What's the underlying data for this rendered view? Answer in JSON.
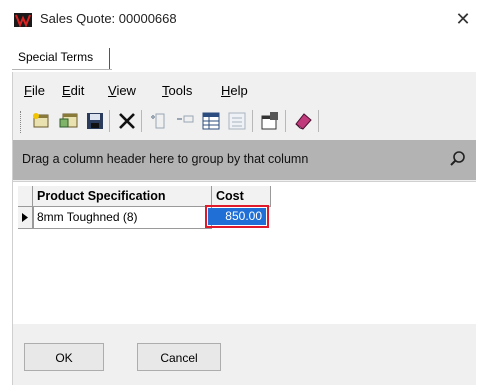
{
  "window": {
    "title": "Sales Quote: 00000668",
    "close_glyph": "✕"
  },
  "tab": {
    "label": "Special Terms"
  },
  "menu": {
    "items": [
      {
        "label": "File"
      },
      {
        "label": "Edit"
      },
      {
        "label": "View"
      },
      {
        "label": "Tools"
      },
      {
        "label": "Help"
      }
    ]
  },
  "toolbar": {
    "icons": [
      "new-record-icon",
      "new-child-icon",
      "save-icon",
      "delete-icon",
      "insert-row-icon",
      "remove-row-icon",
      "grid-view-icon",
      "card-view-icon",
      "properties-icon",
      "eraser-icon"
    ]
  },
  "grid": {
    "group_hint": "Drag a column header here to group by that column",
    "columns": [
      "Product Specification",
      "Cost"
    ],
    "rows": [
      {
        "product": "8mm Toughned (8)",
        "cost": "850.00"
      }
    ],
    "colors": {
      "selection": "#1f6fd6",
      "highlight_border": "#e01a2b"
    }
  },
  "buttons": {
    "ok": "OK",
    "cancel": "Cancel"
  }
}
